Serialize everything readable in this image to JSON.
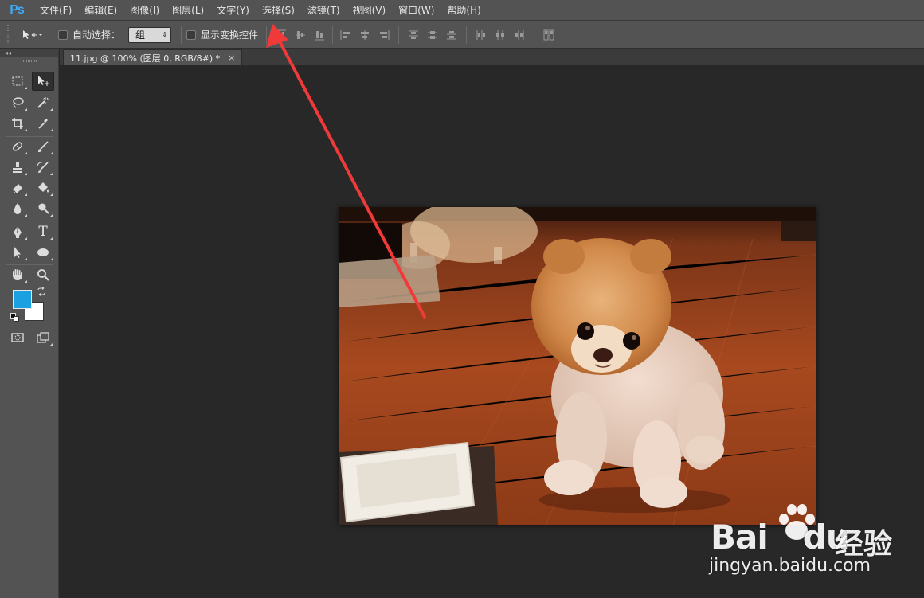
{
  "app": {
    "logo": "Ps"
  },
  "menu": [
    "文件(F)",
    "编辑(E)",
    "图像(I)",
    "图层(L)",
    "文字(Y)",
    "选择(S)",
    "滤镜(T)",
    "视图(V)",
    "窗口(W)",
    "帮助(H)"
  ],
  "options": {
    "auto_select_label": "自动选择：",
    "auto_select_value": "组",
    "show_transform_label": "显示变换控件"
  },
  "document": {
    "tab_title": "11.jpg @ 100% (图层 0, RGB/8#) *",
    "close_glyph": "×"
  },
  "toolbox": {
    "collapse_glyph": "◂◂",
    "tools": [
      "rectangular-marquee",
      "move",
      "lasso",
      "magic-wand",
      "crop",
      "eyedropper",
      "healing-brush",
      "brush",
      "clone-stamp",
      "history-brush",
      "eraser",
      "paint-bucket",
      "blur",
      "dodge",
      "pen",
      "type",
      "path-selection",
      "ellipse",
      "hand",
      "zoom"
    ],
    "type_tool_glyph": "T",
    "foreground_color": "#1ba1e2",
    "background_color": "#ffffff"
  },
  "watermark": {
    "brand": "Bai",
    "brand_tail": "du",
    "brand_cn": "经验",
    "url": "jingyan.baidu.com"
  },
  "colors": {
    "ui_panel": "#535353",
    "canvas_bg": "#282828",
    "annotation_arrow": "#f03a3a",
    "ps_logo": "#3fa9f5"
  }
}
